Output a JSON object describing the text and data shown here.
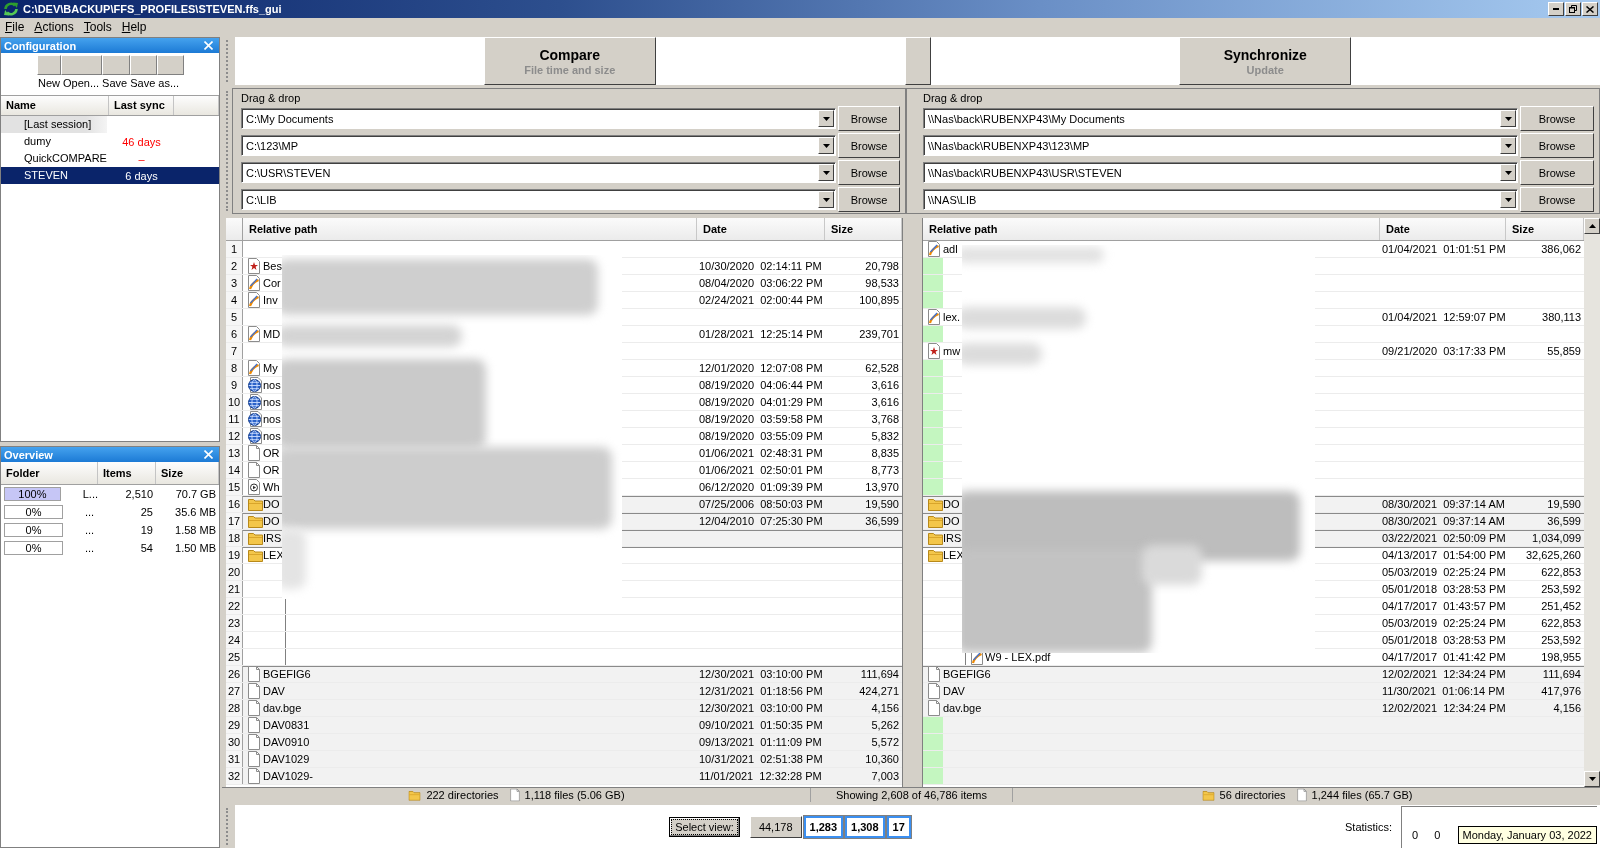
{
  "window": {
    "title": "C:\\DEV\\BACKUP\\FFS_PROFILES\\STEVEN.ffs_gui"
  },
  "menu": [
    "File",
    "Actions",
    "Tools",
    "Help"
  ],
  "configuration": {
    "title": "Configuration",
    "toolbar": [
      {
        "label": "New"
      },
      {
        "label": "Open..."
      },
      {
        "label": "Save"
      },
      {
        "label": "Save as..."
      }
    ],
    "columns": [
      "Name",
      "Last sync"
    ],
    "items": [
      {
        "kind": "session",
        "name": "[Last session]",
        "selected": false
      },
      {
        "kind": "profile",
        "name": "dumy",
        "last_sync": "46 days",
        "overdue": true,
        "selected": false
      },
      {
        "kind": "profile",
        "name": "QuickCOMPARE",
        "last_sync": "–",
        "overdue": true,
        "selected": false
      },
      {
        "kind": "profile",
        "name": "STEVEN",
        "last_sync": "6 days",
        "overdue": false,
        "selected": true
      }
    ]
  },
  "overview": {
    "title": "Overview",
    "columns": [
      "Folder",
      "Items",
      "Size"
    ],
    "rows": [
      {
        "level": 1,
        "percent": "100%",
        "folder": "L...",
        "items": "2,510",
        "size": "70.7 GB"
      },
      {
        "level": 0,
        "percent": "0%",
        "folder": "...",
        "items": "25",
        "size": "35.6 MB"
      },
      {
        "level": 0,
        "percent": "0%",
        "folder": "...",
        "items": "19",
        "size": "1.58 MB"
      },
      {
        "level": 0,
        "percent": "0%",
        "folder": "...",
        "items": "54",
        "size": "1.50 MB"
      }
    ]
  },
  "compare": {
    "label": "Compare",
    "sublabel": "File time and size"
  },
  "synchronize": {
    "label": "Synchronize",
    "sublabel": "Update"
  },
  "folder_pairs": {
    "left": {
      "caption": "Drag & drop",
      "rows": [
        {
          "path": "C:\\My Documents",
          "button": "Browse"
        },
        {
          "path": "C:\\123\\MP",
          "button": "Browse"
        },
        {
          "path": "C:\\USR\\STEVEN",
          "button": "Browse"
        },
        {
          "path": "C:\\LIB",
          "button": "Browse"
        }
      ]
    },
    "right": {
      "caption": "Drag & drop",
      "rows": [
        {
          "path": "\\\\Nas\\back\\RUBENXP43\\My Documents",
          "button": "Browse"
        },
        {
          "path": "\\\\Nas\\back\\RUBENXP43\\123\\MP",
          "button": "Browse"
        },
        {
          "path": "\\\\Nas\\back\\RUBENXP43\\USR\\STEVEN",
          "button": "Browse"
        },
        {
          "path": "\\\\NAS\\LIB",
          "button": "Browse"
        }
      ]
    }
  },
  "comparison": {
    "left_columns": [
      "Relative path",
      "Date",
      "Size"
    ],
    "right_columns": [
      "Relative path",
      "Date",
      "Size"
    ],
    "rows": [
      {
        "number": "1",
        "shaded": false,
        "group_start": false,
        "left": {
          "tree_guide": false
        },
        "right": {
          "kind": "swoosh",
          "name": "adl",
          "date": "01/04/2021  01:01:51 PM",
          "size": "386,062",
          "tree_guide": false,
          "highlighted": false
        }
      },
      {
        "number": "2",
        "shaded": false,
        "group_start": false,
        "left": {
          "kind": "star",
          "name": "Bes",
          "date": "10/30/2020  02:14:11 PM",
          "size": "20,798",
          "tree_guide": false
        },
        "right": {
          "tree_guide": false,
          "highlighted": true
        }
      },
      {
        "number": "3",
        "shaded": false,
        "group_start": false,
        "left": {
          "kind": "swoosh",
          "name": "Cor",
          "date": "08/04/2020  03:06:22 PM",
          "size": "98,533",
          "tree_guide": false
        },
        "right": {
          "tree_guide": false,
          "highlighted": true
        }
      },
      {
        "number": "4",
        "shaded": false,
        "group_start": false,
        "left": {
          "kind": "swoosh",
          "name": "Inv",
          "date": "02/24/2021  02:00:44 PM",
          "size": "100,895",
          "tree_guide": false
        },
        "right": {
          "tree_guide": false,
          "highlighted": true
        }
      },
      {
        "number": "5",
        "shaded": false,
        "group_start": false,
        "left": {
          "tree_guide": false
        },
        "right": {
          "kind": "swoosh",
          "name": "lex.",
          "date": "01/04/2021  12:59:07 PM",
          "size": "380,113",
          "tree_guide": false,
          "highlighted": false
        }
      },
      {
        "number": "6",
        "shaded": false,
        "group_start": false,
        "left": {
          "kind": "swoosh",
          "name": "MD",
          "date": "01/28/2021  12:25:14 PM",
          "size": "239,701",
          "tree_guide": false
        },
        "right": {
          "tree_guide": false,
          "highlighted": true
        }
      },
      {
        "number": "7",
        "shaded": false,
        "group_start": false,
        "left": {
          "tree_guide": false
        },
        "right": {
          "kind": "star",
          "name": "mw",
          "date": "09/21/2020  03:17:33 PM",
          "size": "55,859",
          "tree_guide": false,
          "highlighted": false
        }
      },
      {
        "number": "8",
        "shaded": false,
        "group_start": false,
        "left": {
          "kind": "swoosh",
          "name": "My",
          "date": "12/01/2020  12:07:08 PM",
          "size": "62,528",
          "tree_guide": false
        },
        "right": {
          "tree_guide": false,
          "highlighted": true
        }
      },
      {
        "number": "9",
        "shaded": false,
        "group_start": false,
        "left": {
          "kind": "globe",
          "name": "nos",
          "date": "08/19/2020  04:06:44 PM",
          "size": "3,616",
          "tree_guide": false
        },
        "right": {
          "tree_guide": false,
          "highlighted": true
        }
      },
      {
        "number": "10",
        "shaded": false,
        "group_start": false,
        "left": {
          "kind": "globe",
          "name": "nos",
          "date": "08/19/2020  04:01:29 PM",
          "size": "3,616",
          "tree_guide": false
        },
        "right": {
          "tree_guide": false,
          "highlighted": true
        }
      },
      {
        "number": "11",
        "shaded": false,
        "group_start": false,
        "left": {
          "kind": "globe",
          "name": "nos",
          "date": "08/19/2020  03:59:58 PM",
          "size": "3,768",
          "tree_guide": false
        },
        "right": {
          "tree_guide": false,
          "highlighted": true
        }
      },
      {
        "number": "12",
        "shaded": false,
        "group_start": false,
        "left": {
          "kind": "globe",
          "name": "nos",
          "date": "08/19/2020  03:55:09 PM",
          "size": "5,832",
          "tree_guide": false
        },
        "right": {
          "tree_guide": false,
          "highlighted": true
        }
      },
      {
        "number": "13",
        "shaded": false,
        "group_start": false,
        "left": {
          "kind": "blank",
          "name": "OR",
          "date": "01/06/2021  02:48:31 PM",
          "size": "8,835",
          "tree_guide": false
        },
        "right": {
          "tree_guide": false,
          "highlighted": true
        }
      },
      {
        "number": "14",
        "shaded": false,
        "group_start": false,
        "left": {
          "kind": "blank",
          "name": "OR",
          "date": "01/06/2021  02:50:01 PM",
          "size": "8,773",
          "tree_guide": false
        },
        "right": {
          "tree_guide": false,
          "highlighted": true
        }
      },
      {
        "number": "15",
        "shaded": false,
        "group_start": false,
        "left": {
          "kind": "play",
          "name": "Wh",
          "date": "06/12/2020  01:09:39 PM",
          "size": "13,970",
          "tree_guide": false
        },
        "right": {
          "tree_guide": false,
          "highlighted": true
        }
      },
      {
        "number": "16",
        "shaded": true,
        "group_start": true,
        "left": {
          "kind": "folder",
          "name": "DO",
          "date": "07/25/2006  08:50:03 PM",
          "size": "19,590",
          "tree_guide": false
        },
        "right": {
          "kind": "folder",
          "name": "DO",
          "date": "08/30/2021  09:37:14 AM",
          "size": "19,590",
          "tree_guide": false,
          "highlighted": false
        }
      },
      {
        "number": "17",
        "shaded": true,
        "group_start": true,
        "left": {
          "kind": "folder",
          "name": "DO",
          "date": "12/04/2010  07:25:30 PM",
          "size": "36,599",
          "tree_guide": false
        },
        "right": {
          "kind": "folder",
          "name": "DO",
          "date": "08/30/2021  09:37:14 AM",
          "size": "36,599",
          "tree_guide": false,
          "highlighted": false
        }
      },
      {
        "number": "18",
        "shaded": true,
        "group_start": true,
        "left": {
          "kind": "folder",
          "name": "IRS",
          "tree_guide": false
        },
        "right": {
          "kind": "folder",
          "name": "IRS",
          "date": "03/22/2021  02:50:09 PM",
          "size": "1,034,099",
          "tree_guide": false,
          "highlighted": false
        }
      },
      {
        "number": "19",
        "shaded": false,
        "group_start": true,
        "left": {
          "kind": "folder",
          "name": "LEX",
          "tree_guide": false
        },
        "right": {
          "kind": "folder",
          "name": "LEX",
          "date": "04/13/2017  01:54:00 PM",
          "size": "32,625,260",
          "tree_guide": false,
          "highlighted": false
        }
      },
      {
        "number": "20",
        "shaded": false,
        "group_start": false,
        "left": {
          "tree_guide": false
        },
        "right": {
          "date": "05/03/2019  02:25:24 PM",
          "size": "622,853",
          "tree_guide": false,
          "highlighted": false
        }
      },
      {
        "number": "21",
        "shaded": false,
        "group_start": false,
        "left": {
          "tree_guide": false
        },
        "right": {
          "date": "05/01/2018  03:28:53 PM",
          "size": "253,592",
          "tree_guide": false,
          "highlighted": false
        }
      },
      {
        "number": "22",
        "shaded": false,
        "group_start": false,
        "left": {
          "tree_guide": true
        },
        "right": {
          "date": "04/17/2017  01:43:57 PM",
          "size": "251,452",
          "tree_guide": false,
          "highlighted": false
        }
      },
      {
        "number": "23",
        "shaded": false,
        "group_start": false,
        "left": {
          "tree_guide": true
        },
        "right": {
          "date": "05/03/2019  02:25:24 PM",
          "size": "622,853",
          "tree_guide": false,
          "highlighted": false
        }
      },
      {
        "number": "24",
        "shaded": false,
        "group_start": false,
        "left": {
          "tree_guide": true
        },
        "right": {
          "date": "05/01/2018  03:28:53 PM",
          "size": "253,592",
          "tree_guide": false,
          "highlighted": false
        }
      },
      {
        "number": "25",
        "shaded": false,
        "group_start": false,
        "left": {
          "tree_guide": true
        },
        "right": {
          "kind": "swoosh",
          "name": "W9 - LEX.pdf",
          "date": "04/17/2017  01:41:42 PM",
          "size": "198,955",
          "tree_guide": true,
          "highlighted": false
        }
      },
      {
        "number": "26",
        "shaded": true,
        "group_start": true,
        "left": {
          "kind": "blank",
          "name": "BGEFIG6",
          "date": "12/30/2021  03:10:00 PM",
          "size": "111,694",
          "tree_guide": false
        },
        "right": {
          "kind": "blank",
          "name": "BGEFIG6",
          "date": "12/02/2021  12:34:24 PM",
          "size": "111,694",
          "tree_guide": false,
          "highlighted": false
        }
      },
      {
        "number": "27",
        "shaded": true,
        "group_start": false,
        "left": {
          "kind": "blank",
          "name": "DAV",
          "date": "12/31/2021  01:18:56 PM",
          "size": "424,271",
          "tree_guide": false
        },
        "right": {
          "kind": "blank",
          "name": "DAV",
          "date": "11/30/2021  01:06:14 PM",
          "size": "417,976",
          "tree_guide": false,
          "highlighted": false
        }
      },
      {
        "number": "28",
        "shaded": true,
        "group_start": false,
        "left": {
          "kind": "blank",
          "name": "dav.bge",
          "date": "12/30/2021  03:10:00 PM",
          "size": "4,156",
          "tree_guide": false
        },
        "right": {
          "kind": "blank",
          "name": "dav.bge",
          "date": "12/02/2021  12:34:24 PM",
          "size": "4,156",
          "tree_guide": false,
          "highlighted": false
        }
      },
      {
        "number": "29",
        "shaded": true,
        "group_start": false,
        "left": {
          "kind": "blank",
          "name": "DAV0831",
          "date": "09/10/2021  01:50:35 PM",
          "size": "5,262",
          "tree_guide": false
        },
        "right": {
          "tree_guide": false,
          "highlighted": true
        }
      },
      {
        "number": "30",
        "shaded": true,
        "group_start": false,
        "left": {
          "kind": "blank",
          "name": "DAV0910",
          "date": "09/13/2021  01:11:09 PM",
          "size": "5,572",
          "tree_guide": false
        },
        "right": {
          "tree_guide": false,
          "highlighted": true
        }
      },
      {
        "number": "31",
        "shaded": true,
        "group_start": false,
        "left": {
          "kind": "blank",
          "name": "DAV1029",
          "date": "10/31/2021  02:51:38 PM",
          "size": "10,360",
          "tree_guide": false
        },
        "right": {
          "tree_guide": false,
          "highlighted": true
        }
      },
      {
        "number": "32",
        "shaded": true,
        "group_start": false,
        "left": {
          "kind": "blank",
          "name": "DAV1029-",
          "date": "11/01/2021  12:32:28 PM",
          "size": "7,003",
          "tree_guide": false
        },
        "right": {
          "tree_guide": false,
          "highlighted": true
        }
      }
    ]
  },
  "status_bar": {
    "left": {
      "directories": "222 directories",
      "files": "1,118 files (5.06 GB)"
    },
    "center": "Showing 2,608 of 46,786 items",
    "right": {
      "directories": "56 directories",
      "files": "1,244 files (65.7 GB)"
    }
  },
  "view": {
    "button": "Select view:",
    "filters": [
      {
        "label": "44,178",
        "selected": false
      },
      {
        "label": "1,283",
        "selected": true
      },
      {
        "label": "1,308",
        "selected": true
      },
      {
        "label": "17",
        "selected": true
      }
    ]
  },
  "statistics": {
    "label": "Statistics:",
    "values": [
      "0",
      "0"
    ]
  },
  "tooltip": {
    "text": "Monday, January 03, 2022"
  }
}
